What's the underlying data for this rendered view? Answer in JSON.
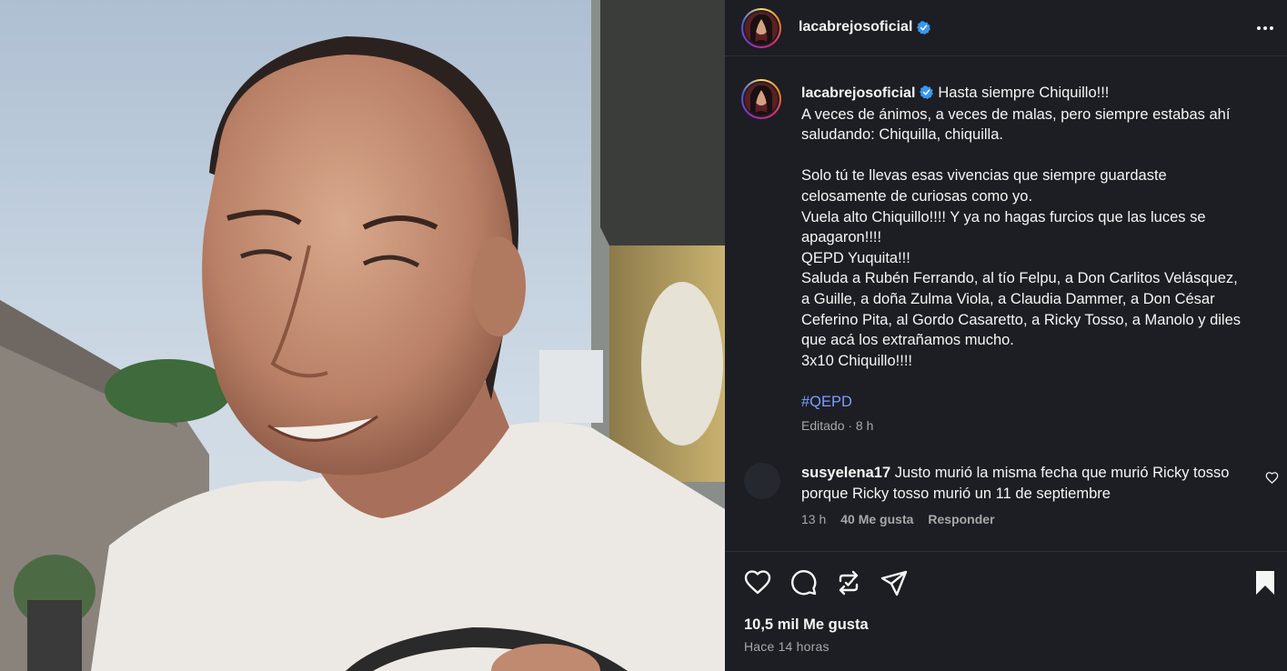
{
  "post": {
    "username": "lacabrejosoficial",
    "caption_lines": [
      "Hasta siempre Chiquillo!!!",
      "A veces de ánimos, a veces de malas, pero siempre estabas ahí",
      "saludando: Chiquilla, chiquilla.",
      "",
      "Solo tú te llevas esas vivencias que siempre guardaste",
      "celosamente de curiosas como yo.",
      "Vuela alto Chiquillo!!!! Y ya no hagas furcios que las luces se",
      "apagaron!!!!",
      "QEPD Yuquita!!!",
      "Saluda a Rubén Ferrando, al tío Felpu, a Don Carlitos Velásquez,",
      "a Guille, a doña Zulma Viola, a Claudia Dammer, a Don César",
      "Ceferino Pita, al Gordo Casaretto, a Ricky Tosso, a Manolo y diles",
      "que acá los extrañamos mucho.",
      "3x10 Chiquillo!!!!",
      "",
      "#QEPD"
    ],
    "hashtag": "#QEPD",
    "meta": "Editado · 8 h",
    "likes": "10,5 mil Me gusta",
    "time": "Hace 14 horas"
  },
  "comment": {
    "username": "susyelena17",
    "text_line1": "Justo murió la misma fecha que murió Ricky tosso",
    "text_line2": "porque Ricky tosso murió un 11 de septiembre",
    "time": "13 h",
    "likes": "40 Me gusta",
    "reply": "Responder"
  },
  "icons": {
    "verified": "verified-badge-icon",
    "more": "more-options-icon",
    "like": "heart-icon",
    "comment": "comment-bubble-icon",
    "repost": "repost-icon",
    "share": "send-icon",
    "save": "bookmark-icon"
  },
  "colors": {
    "panel_bg": "#1c1e24",
    "verified": "#3897f0",
    "hashtag": "#7f9cff",
    "muted": "#a8a8a8"
  }
}
